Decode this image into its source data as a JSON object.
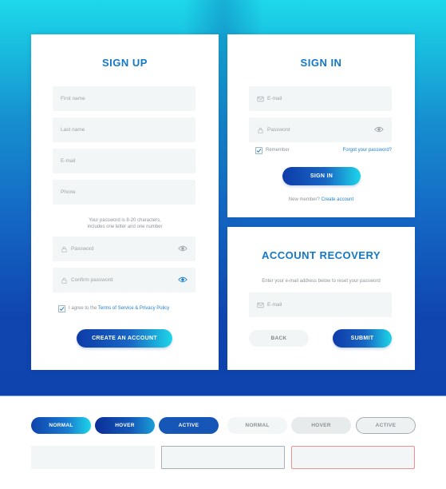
{
  "colors": {
    "accent": "#1478c8",
    "link": "#1e7fcf",
    "gradient_start": "#0e3ba8",
    "gradient_end": "#1dd5e8",
    "field_bg": "#f3f6f6",
    "error_border": "#f08f8f"
  },
  "signup": {
    "title": "SIGN UP",
    "fields": {
      "first_name": {
        "placeholder": "First name"
      },
      "last_name": {
        "placeholder": "Last name"
      },
      "email": {
        "placeholder": "E-mail"
      },
      "phone": {
        "placeholder": "Phone"
      },
      "password": {
        "placeholder": "Password",
        "icon": "lock-icon",
        "trailing_icon": "eye-icon"
      },
      "confirm_password": {
        "placeholder": "Confirm password",
        "icon": "lock-icon",
        "trailing_icon": "eye-icon"
      }
    },
    "password_hint_line1": "Your password is 8-20 characters,",
    "password_hint_line2": "includes one letter and one number",
    "agree": {
      "checked": true,
      "prefix": "I agree to the ",
      "link": "Terms of Service & Privacy Policy"
    },
    "submit_label": "CREATE AN ACCOUNT"
  },
  "signin": {
    "title": "SIGN IN",
    "fields": {
      "email": {
        "placeholder": "E-mail",
        "icon": "mail-icon"
      },
      "password": {
        "placeholder": "Password",
        "icon": "lock-icon",
        "trailing_icon": "eye-icon"
      }
    },
    "remember": {
      "checked": true,
      "label": "Remember"
    },
    "forgot_label": "Forgot your password?",
    "submit_label": "SIGN IN",
    "new_member_prefix": "New member? ",
    "create_account_link": "Create account"
  },
  "recovery": {
    "title": "ACCOUNT RECOVERY",
    "instruction": "Enter your e-mail address below to reset your password",
    "fields": {
      "email": {
        "placeholder": "E-mail",
        "icon": "mail-icon"
      }
    },
    "back_label": "BACK",
    "submit_label": "SUBMIT"
  },
  "states": {
    "dark_buttons": [
      "NORMAL",
      "HOVER",
      "ACTIVE"
    ],
    "light_buttons": [
      "NORMAL",
      "HOVER",
      "ACTIVE"
    ],
    "fields": [
      "normal",
      "focus",
      "error"
    ]
  }
}
